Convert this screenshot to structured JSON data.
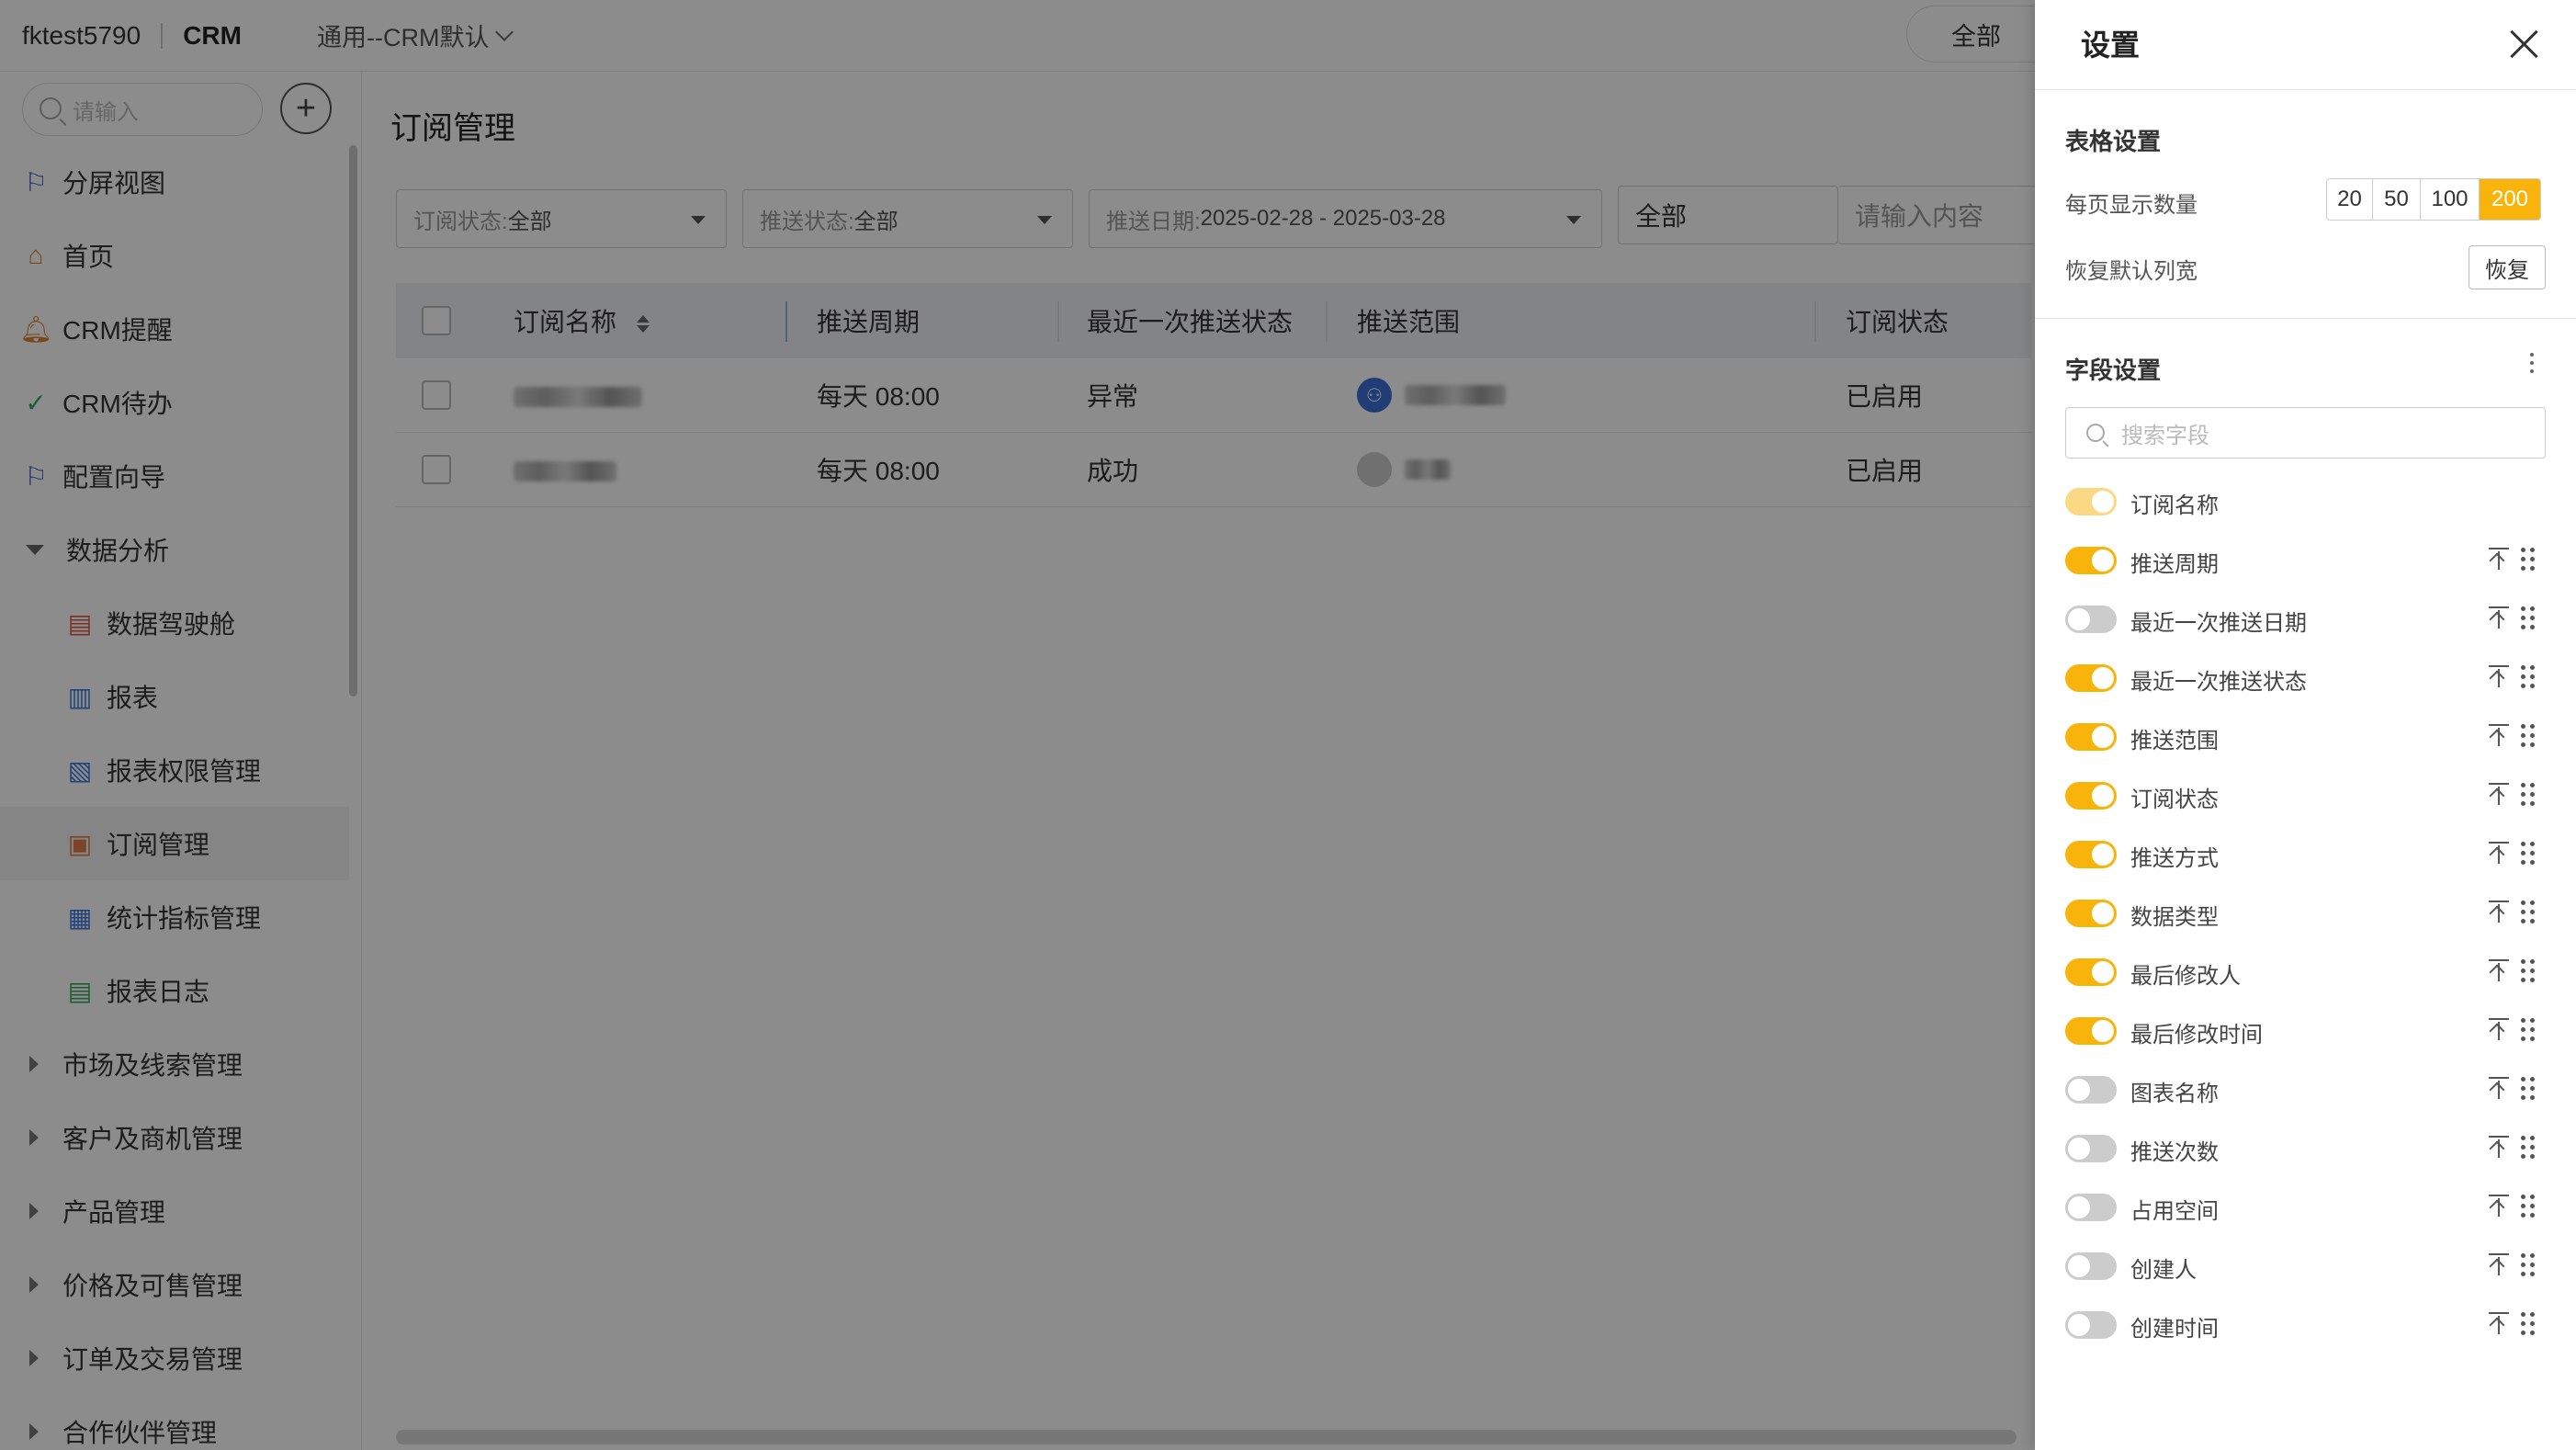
{
  "topbar": {
    "username": "fktest5790",
    "app": "CRM",
    "role": "通用--CRM默认",
    "scope": "全部"
  },
  "sidebar": {
    "search_placeholder": "请输入",
    "items": [
      {
        "label": "分屏视图",
        "icon": "flag-icon"
      },
      {
        "label": "首页",
        "icon": "home-icon"
      },
      {
        "label": "CRM提醒",
        "icon": "bell-icon"
      },
      {
        "label": "CRM待办",
        "icon": "check-circle-icon"
      },
      {
        "label": "配置向导",
        "icon": "flag-icon"
      },
      {
        "label": "数据分析",
        "icon": "caret-down-icon"
      },
      {
        "label": "数据驾驶舱",
        "icon": "dashboard-icon"
      },
      {
        "label": "报表",
        "icon": "clipboard-icon"
      },
      {
        "label": "报表权限管理",
        "icon": "report-permission-icon"
      },
      {
        "label": "订阅管理",
        "icon": "subscription-icon"
      },
      {
        "label": "统计指标管理",
        "icon": "metrics-icon"
      },
      {
        "label": "报表日志",
        "icon": "log-icon"
      },
      {
        "label": "市场及线索管理",
        "icon": "caret-right-icon"
      },
      {
        "label": "客户及商机管理",
        "icon": "caret-right-icon"
      },
      {
        "label": "产品管理",
        "icon": "caret-right-icon"
      },
      {
        "label": "价格及可售管理",
        "icon": "caret-right-icon"
      },
      {
        "label": "订单及交易管理",
        "icon": "caret-right-icon"
      },
      {
        "label": "合作伙伴管理",
        "icon": "caret-right-icon"
      }
    ]
  },
  "main": {
    "title": "订阅管理",
    "filters": {
      "sub_status_label": "订阅状态:",
      "sub_status_value": "全部",
      "push_status_label": "推送状态:",
      "push_status_value": "全部",
      "push_date_label": "推送日期:",
      "push_date_value": "2025-02-28 - 2025-03-28",
      "scope_value": "全部",
      "search_placeholder": "请输入内容"
    },
    "table": {
      "headers": [
        "订阅名称",
        "推送周期",
        "最近一次推送状态",
        "推送范围",
        "订阅状态"
      ],
      "rows": [
        {
          "cycle": "每天 08:00",
          "last_status": "异常",
          "sub_status": "已启用"
        },
        {
          "cycle": "每天 08:00",
          "last_status": "成功",
          "sub_status": "已启用"
        }
      ]
    }
  },
  "panel": {
    "title": "设置",
    "table_settings_title": "表格设置",
    "page_size_label": "每页显示数量",
    "page_sizes": [
      "20",
      "50",
      "100",
      "200"
    ],
    "page_size_selected": "200",
    "restore_width_label": "恢复默认列宽",
    "restore_button": "恢复",
    "field_settings_title": "字段设置",
    "field_search_placeholder": "搜索字段",
    "fields": [
      {
        "name": "订阅名称",
        "on": true,
        "locked": true
      },
      {
        "name": "推送周期",
        "on": true
      },
      {
        "name": "最近一次推送日期",
        "on": false
      },
      {
        "name": "最近一次推送状态",
        "on": true
      },
      {
        "name": "推送范围",
        "on": true
      },
      {
        "name": "订阅状态",
        "on": true
      },
      {
        "name": "推送方式",
        "on": true
      },
      {
        "name": "数据类型",
        "on": true
      },
      {
        "name": "最后修改人",
        "on": true
      },
      {
        "name": "最后修改时间",
        "on": true
      },
      {
        "name": "图表名称",
        "on": false
      },
      {
        "name": "推送次数",
        "on": false
      },
      {
        "name": "占用空间",
        "on": false
      },
      {
        "name": "创建人",
        "on": false
      },
      {
        "name": "创建时间",
        "on": false
      }
    ],
    "accent_color": "#f9b40c"
  }
}
